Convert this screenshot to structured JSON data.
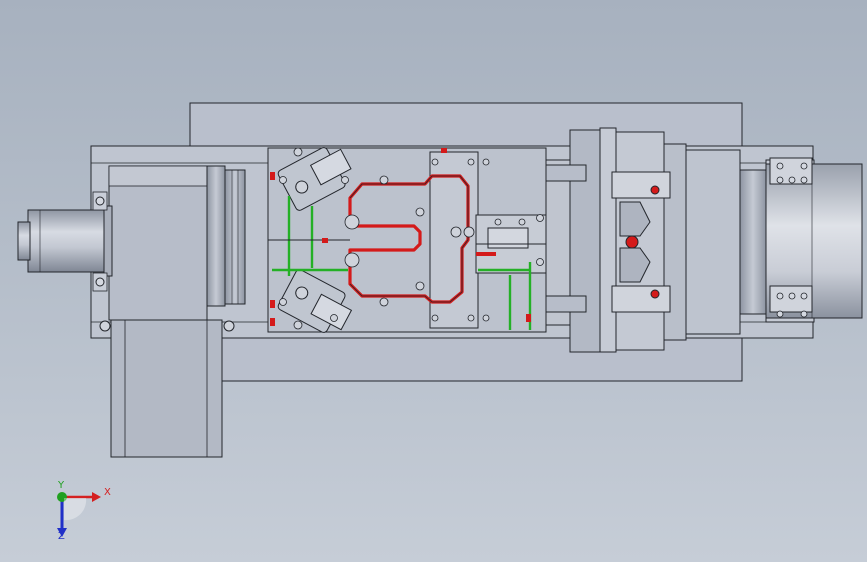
{
  "viewport": {
    "background_top": "#a7b1bf",
    "background_bottom": "#c6cdd7"
  },
  "colors": {
    "steel": "#b9bfcc",
    "steel_light": "#cfd4de",
    "steel_dark": "#9ea5b3",
    "edge": "#23262c",
    "coolant_red": "#d41a1a",
    "coolant_green": "#24b026",
    "axis_x": "#d42020",
    "axis_y": "#20a020",
    "axis_z": "#2030c8"
  },
  "triad": {
    "x_label": "X",
    "y_label": "Y",
    "z_label": "Z"
  }
}
